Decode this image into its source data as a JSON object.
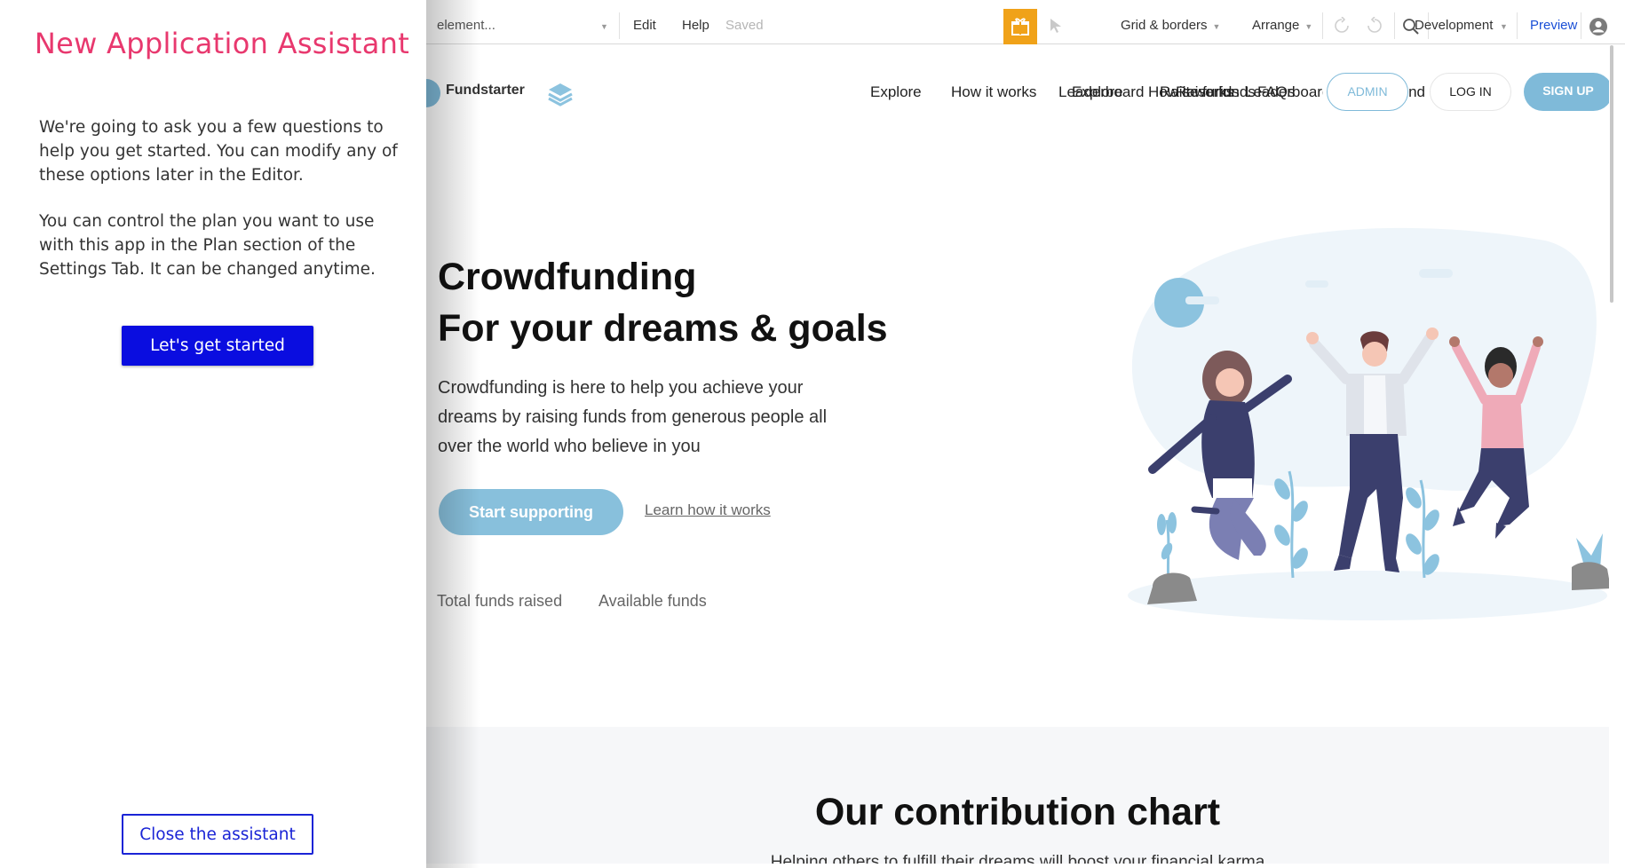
{
  "assistant": {
    "title": "New Application Assistant",
    "paragraph1": "We're going to ask you a few questions to help you get started. You can modify any of these options later in the Editor.",
    "paragraph2": "You can control the plan you want to use with this app in the Plan section of the Settings Tab. It can be changed anytime.",
    "start_button": "Let's get started",
    "close_button": "Close the assistant",
    "colors": {
      "title": "#e8386e",
      "primary_button": "#0a0de0",
      "close_button": "#1a24d6"
    }
  },
  "toolbar": {
    "element_select": "element...",
    "edit": "Edit",
    "help": "Help",
    "saved": "Saved",
    "grid_borders": "Grid & borders",
    "arrange": "Arrange",
    "environment": "Development",
    "preview": "Preview",
    "icons": [
      "gift-icon",
      "cursor-icon",
      "undo-icon",
      "redo-icon",
      "search-icon",
      "account-icon"
    ],
    "colors": {
      "gift_bg": "#f0a219",
      "preview": "#1a4fd6"
    }
  },
  "page": {
    "brand": "Fundstarter",
    "nav": {
      "explore": "Explore",
      "how_it_works": "How it works",
      "overlap1": "Leaderboard",
      "overlap2": "Explore",
      "overlap3": "How it works",
      "overlap4": "Raise funds",
      "overlap5": "Raise funds",
      "overlap6": "FAQs",
      "overlap7": "Leaderboard",
      "overlap8": "Fund"
    },
    "admin": "ADMIN",
    "login": "LOG IN",
    "signup": "SIGN UP",
    "hero": {
      "title_line1": "Crowdfunding",
      "title_line2": "For your dreams & goals",
      "subtitle": "Crowdfunding is here to help you achieve your dreams by raising funds from generous people all over the world who believe in you",
      "primary_cta": "Start supporting",
      "secondary_cta": "Learn how it works"
    },
    "stats": {
      "total": "Total funds raised",
      "available": "Available funds"
    },
    "contribution": {
      "title": "Our contribution chart",
      "subtitle": "Helping others to fulfill their dreams will boost your financial karma"
    },
    "colors": {
      "accent": "#7fbad9"
    }
  }
}
